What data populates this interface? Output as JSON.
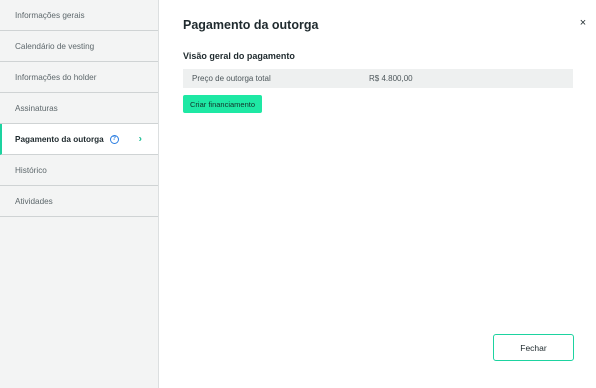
{
  "sidebar": {
    "items": [
      {
        "label": "Informações gerais"
      },
      {
        "label": "Calendário de vesting"
      },
      {
        "label": "Informações do holder"
      },
      {
        "label": "Assinaturas"
      },
      {
        "label": "Pagamento da outorga",
        "active": true,
        "info_icon": "?",
        "chevron": "›"
      },
      {
        "label": "Histórico"
      },
      {
        "label": "Atividades"
      }
    ]
  },
  "main": {
    "title": "Pagamento da outorga",
    "close_icon": "×",
    "section_title": "Visão geral do pagamento",
    "summary": {
      "label": "Preço de outorga total",
      "value": "R$ 4.800,00"
    },
    "finance_button": "Criar financiamento",
    "footer_button": "Fechar"
  },
  "colors": {
    "accent": "#1dd3a0",
    "button_fill": "#1ee8a4",
    "info": "#2a7de1"
  }
}
